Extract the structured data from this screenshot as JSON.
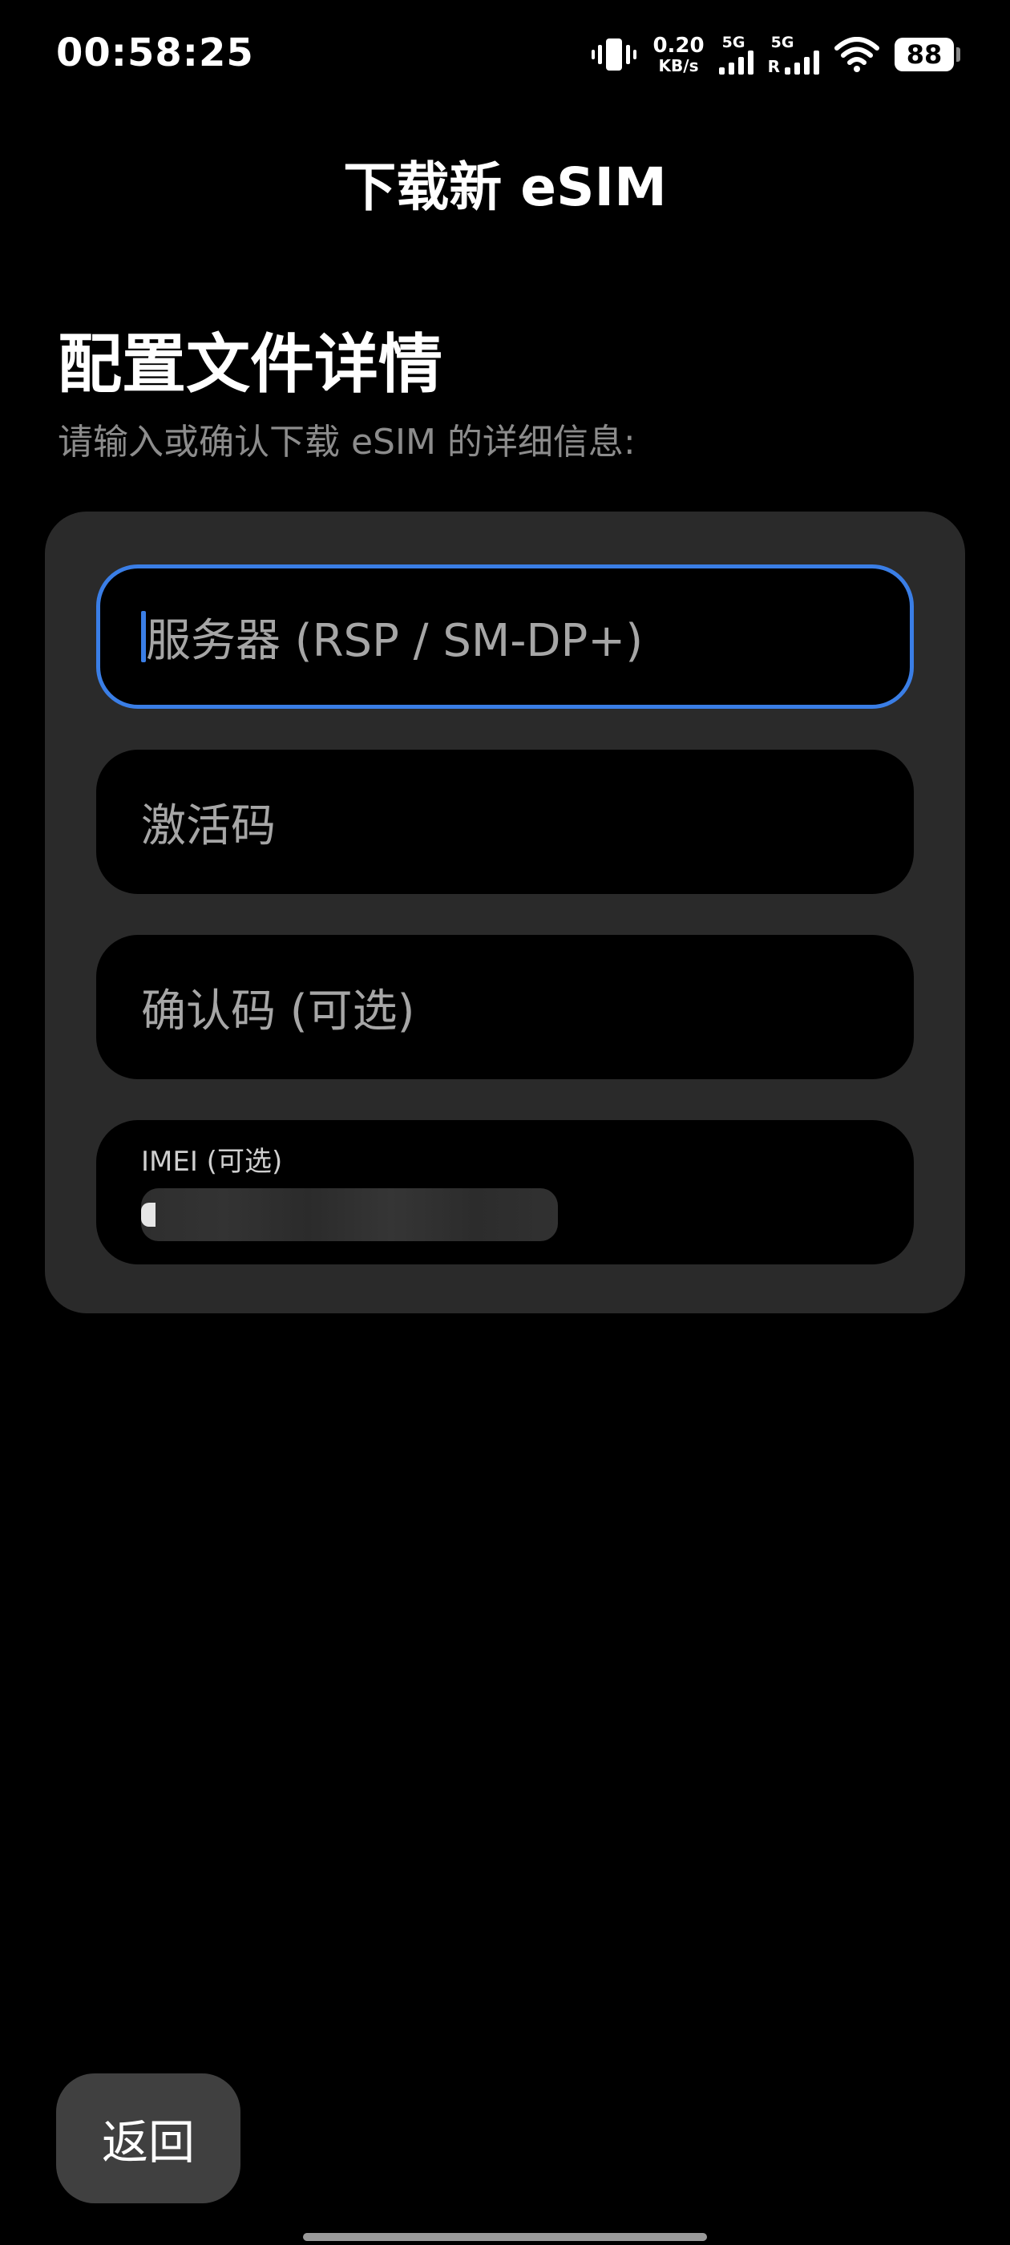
{
  "status_bar": {
    "time": "00:58:25",
    "net_speed_value": "0.20",
    "net_speed_unit": "KB/s",
    "sim1_label": "5G",
    "sim2_label": "5G",
    "sim2_roaming": "R",
    "battery_level": "88",
    "icons": [
      "vibrate-icon",
      "signal-icon",
      "signal-icon",
      "wifi-icon",
      "battery-icon"
    ]
  },
  "header": {
    "title": "下载新 eSIM"
  },
  "section": {
    "title": "配置文件详情",
    "subtitle": "请输入或确认下载 eSIM 的详细信息:"
  },
  "form": {
    "server": {
      "placeholder": "服务器 (RSP / SM-DP+)",
      "value": ""
    },
    "activation_code": {
      "placeholder": "激活码",
      "value": ""
    },
    "confirmation_code": {
      "placeholder": "确认码 (可选)",
      "value": ""
    },
    "imei": {
      "label": "IMEI (可选)"
    }
  },
  "footer": {
    "back_label": "返回"
  },
  "colors": {
    "background": "#000000",
    "card": "#2a2a2a",
    "field": "#000000",
    "accent": "#3a7ee6",
    "placeholder": "#a6a6a6",
    "subtitle": "#8c8c8c",
    "button": "#404040"
  }
}
